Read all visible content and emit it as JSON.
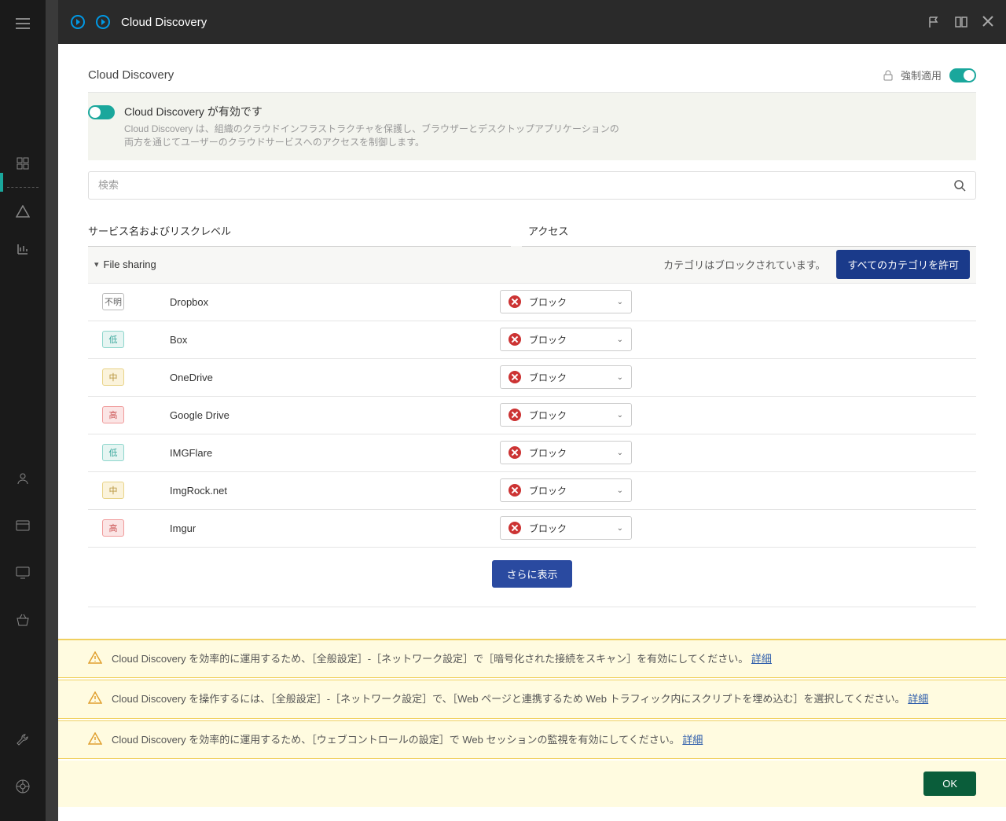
{
  "titlebar": {
    "title": "Cloud Discovery"
  },
  "header": {
    "title": "Cloud Discovery",
    "enforce_label": "強制適用"
  },
  "info": {
    "title": "Cloud Discovery が有効です",
    "desc": "Cloud Discovery は、組織のクラウドインフラストラクチャを保護し、ブラウザーとデスクトップアプリケーションの両方を通じてユーザーのクラウドサービスへのアクセスを制御します。"
  },
  "search": {
    "placeholder": "検索"
  },
  "columns": {
    "name": "サービス名およびリスクレベル",
    "access": "アクセス"
  },
  "category": {
    "name": "File sharing",
    "status": "カテゴリはブロックされています。",
    "allow_all": "すべてのカテゴリを許可"
  },
  "risk_labels": {
    "unknown": "不明",
    "low": "低",
    "medium": "中",
    "high": "高"
  },
  "access_labels": {
    "block": "ブロック"
  },
  "services": [
    {
      "risk": "unknown",
      "name": "Dropbox",
      "access": "block"
    },
    {
      "risk": "low",
      "name": "Box",
      "access": "block"
    },
    {
      "risk": "medium",
      "name": "OneDrive",
      "access": "block"
    },
    {
      "risk": "high",
      "name": "Google Drive",
      "access": "block"
    },
    {
      "risk": "low",
      "name": "IMGFlare",
      "access": "block"
    },
    {
      "risk": "medium",
      "name": "ImgRock.net",
      "access": "block"
    },
    {
      "risk": "high",
      "name": "Imgur",
      "access": "block"
    }
  ],
  "show_more": "さらに表示",
  "warnings": [
    {
      "text": "Cloud Discovery を効率的に運用するため、［全般設定］-［ネットワーク設定］で［暗号化された接続をスキャン］を有効にしてください。",
      "link": "詳細"
    },
    {
      "text": "Cloud Discovery を操作するには、［全般設定］-［ネットワーク設定］で、［Web ページと連携するため Web トラフィック内にスクリプトを埋め込む］を選択してください。",
      "link": "詳細"
    },
    {
      "text": "Cloud Discovery を効率的に運用するため、［ウェブコントロールの設定］で Web セッションの監視を有効にしてください。",
      "link": "詳細"
    }
  ],
  "footer": {
    "ok": "OK"
  }
}
